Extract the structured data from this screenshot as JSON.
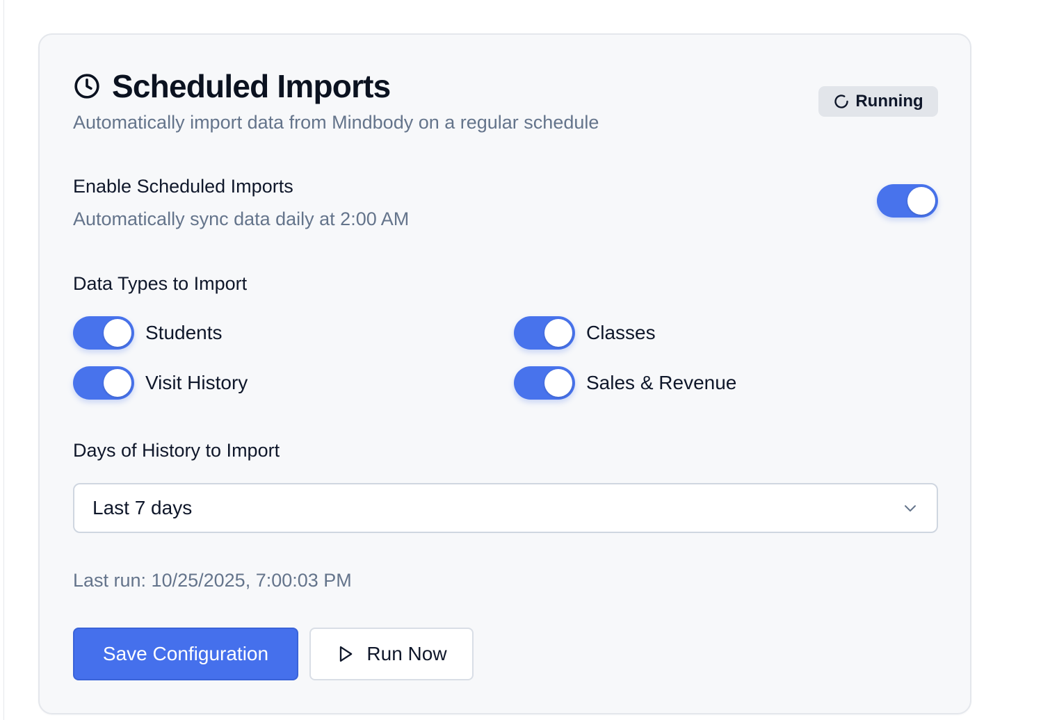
{
  "header": {
    "title": "Scheduled Imports",
    "subtitle": "Automatically import data from Mindbody on a regular schedule",
    "status_badge": "Running",
    "title_icon": "clock-icon",
    "status_icon": "loader-icon"
  },
  "schedule": {
    "label": "Enable Scheduled Imports",
    "description": "Automatically sync data daily at 2:00 AM",
    "enabled": true
  },
  "data_types": {
    "label": "Data Types to Import",
    "items": [
      {
        "label": "Students",
        "enabled": true
      },
      {
        "label": "Classes",
        "enabled": true
      },
      {
        "label": "Visit History",
        "enabled": true
      },
      {
        "label": "Sales & Revenue",
        "enabled": true
      }
    ]
  },
  "history": {
    "label": "Days of History to Import",
    "selected": "Last 7 days",
    "dropdown_icon": "chevron-down-icon"
  },
  "last_run": "Last run: 10/25/2025, 7:00:03 PM",
  "actions": {
    "save_label": "Save Configuration",
    "run_label": "Run Now",
    "run_icon": "play-icon"
  },
  "colors": {
    "accent": "#4873ec",
    "muted_text": "#64748b",
    "card_background": "#f7f8fa",
    "badge_background": "#e2e5ea"
  }
}
